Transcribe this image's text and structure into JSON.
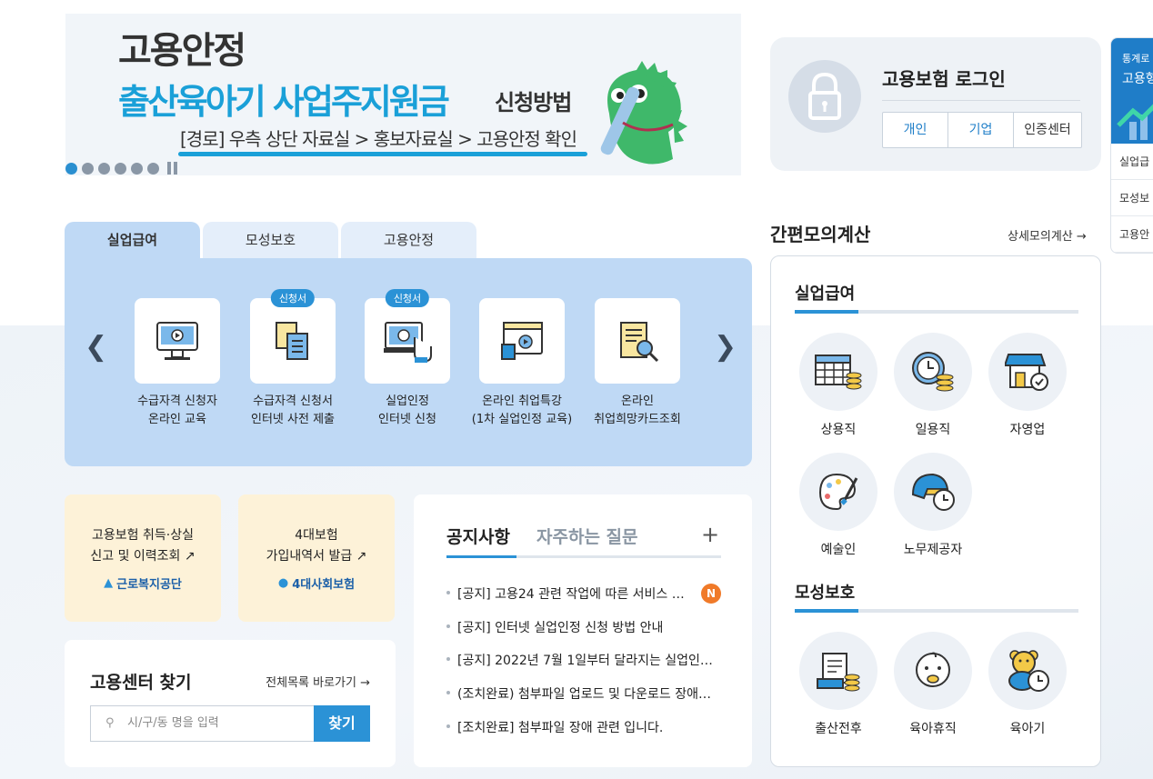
{
  "banner": {
    "line1": "고용안정",
    "line2": "출산육아기 사업주지원금",
    "line2_suffix": "신청방법",
    "line3": "[경로] 우측 상단 자료실 > 홍보자료실 > 고용안정 확인"
  },
  "login": {
    "title": "고용보험 로그인",
    "buttons": [
      "개인",
      "기업",
      "인증센터"
    ]
  },
  "edge": {
    "top_small": "통계로",
    "top_big": "고용형",
    "items": [
      "실업급",
      "모성보",
      "고용안"
    ]
  },
  "tabs": [
    "실업급여",
    "모성보호",
    "고용안정"
  ],
  "services": [
    {
      "line1": "수급자격 신청자",
      "line2": "온라인 교육",
      "badge": ""
    },
    {
      "line1": "수급자격 신청서",
      "line2": "인터넷 사전 제출",
      "badge": "신청서"
    },
    {
      "line1": "실업인정",
      "line2": "인터넷 신청",
      "badge": "신청서"
    },
    {
      "line1": "온라인 취업특강",
      "line2": "(1차 실업인정 교육)",
      "badge": ""
    },
    {
      "line1": "온라인",
      "line2": "취업희망카드조회",
      "badge": ""
    }
  ],
  "cards": [
    {
      "line1": "고용보험 취득·상실",
      "line2": "신고 및 이력조회",
      "logo": "근로복지공단"
    },
    {
      "line1": "4대보험",
      "line2": "가입내역서 발급",
      "logo": "4대사회보험"
    }
  ],
  "find": {
    "title": "고용센터 찾기",
    "link": "전체목록 바로가기",
    "placeholder": "시/구/동 명을 입력",
    "button": "찾기"
  },
  "notice": {
    "tab1": "공지사항",
    "tab2": "자주하는 질문",
    "plus": "+",
    "new_badge": "N",
    "items": [
      "[공지] 고용24 관련 작업에 따른 서비스 …",
      "[공지] 인터넷 실업인정 신청 방법 안내",
      "[공지] 2022년 7월 1일부터 달라지는 실업인…",
      "(조치완료) 첨부파일 업로드 및 다운로드 장애…",
      "[조치완료] 첨부파일 장애 관련 입니다."
    ]
  },
  "calc": {
    "title": "간편모의계산",
    "link": "상세모의계산",
    "section1": "실업급여",
    "section1_items": [
      "상용직",
      "일용직",
      "자영업",
      "예술인",
      "노무제공자"
    ],
    "section2": "모성보호",
    "section2_items": [
      "출산전후",
      "육아휴직",
      "육아기"
    ]
  },
  "colors": {
    "accent": "#2b92d6",
    "tab_panel": "#bfd9f5",
    "card_yellow": "#fdf2d8",
    "badge_new": "#f07a29"
  }
}
